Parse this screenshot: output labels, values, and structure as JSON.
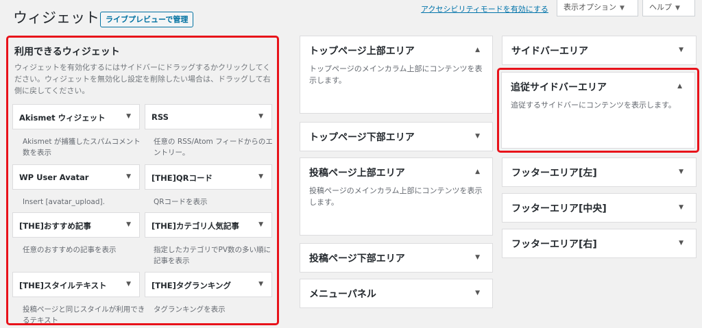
{
  "header": {
    "title": "ウィジェット",
    "live_preview": "ライブプレビューで管理",
    "a11y_link": "アクセシビリティモードを有効にする",
    "screen_options": "表示オプション",
    "help": "ヘルプ",
    "caret": "▼"
  },
  "available": {
    "title": "利用できるウィジェット",
    "description": "ウィジェットを有効化するにはサイドバーにドラッグするかクリックしてください。ウィジェットを無効化し設定を削除したい場合は、ドラッグして右側に戻してください。",
    "widgets": [
      {
        "name": "Akismet ウィジェット",
        "desc": "Akismet が捕獲したスパムコメント数を表示"
      },
      {
        "name": "RSS",
        "desc": "任意の RSS/Atom フィードからのエントリー。"
      },
      {
        "name": "WP User Avatar",
        "desc": "Insert [avatar_upload]."
      },
      {
        "name": "[THE]QRコード",
        "desc": "QRコードを表示"
      },
      {
        "name": "[THE]おすすめ記事",
        "desc": "任意のおすすめの記事を表示"
      },
      {
        "name": "[THE]カテゴリ人気記事",
        "desc": "指定したカテゴリでPV数の多い順に記事を表示"
      },
      {
        "name": "[THE]スタイルテキスト",
        "desc": "投稿ページと同じスタイルが利用できるテキスト"
      },
      {
        "name": "[THE]タグランキング",
        "desc": "タグランキングを表示"
      }
    ]
  },
  "areas_col1": [
    {
      "title": "トップページ上部エリア",
      "arrow": "▲",
      "desc": "トップページのメインカラム上部にコンテンツを表示します。"
    },
    {
      "title": "トップページ下部エリア",
      "arrow": "▼"
    },
    {
      "title": "投稿ページ上部エリア",
      "arrow": "▲",
      "desc": "投稿ページのメインカラム上部にコンテンツを表示します。"
    },
    {
      "title": "投稿ページ下部エリア",
      "arrow": "▼"
    },
    {
      "title": "メニューパネル",
      "arrow": "▼"
    }
  ],
  "areas_col2": [
    {
      "title": "サイドバーエリア",
      "arrow": "▼"
    },
    {
      "title": "追従サイドバーエリア",
      "arrow": "▲",
      "desc": "追従するサイドバーにコンテンツを表示します。"
    },
    {
      "title": "フッターエリア[左]",
      "arrow": "▼"
    },
    {
      "title": "フッターエリア[中央]",
      "arrow": "▼"
    },
    {
      "title": "フッターエリア[右]",
      "arrow": "▼"
    }
  ],
  "colors": {
    "highlight": "#e8121a",
    "link": "#0073aa",
    "button_border": "#0071a1"
  }
}
